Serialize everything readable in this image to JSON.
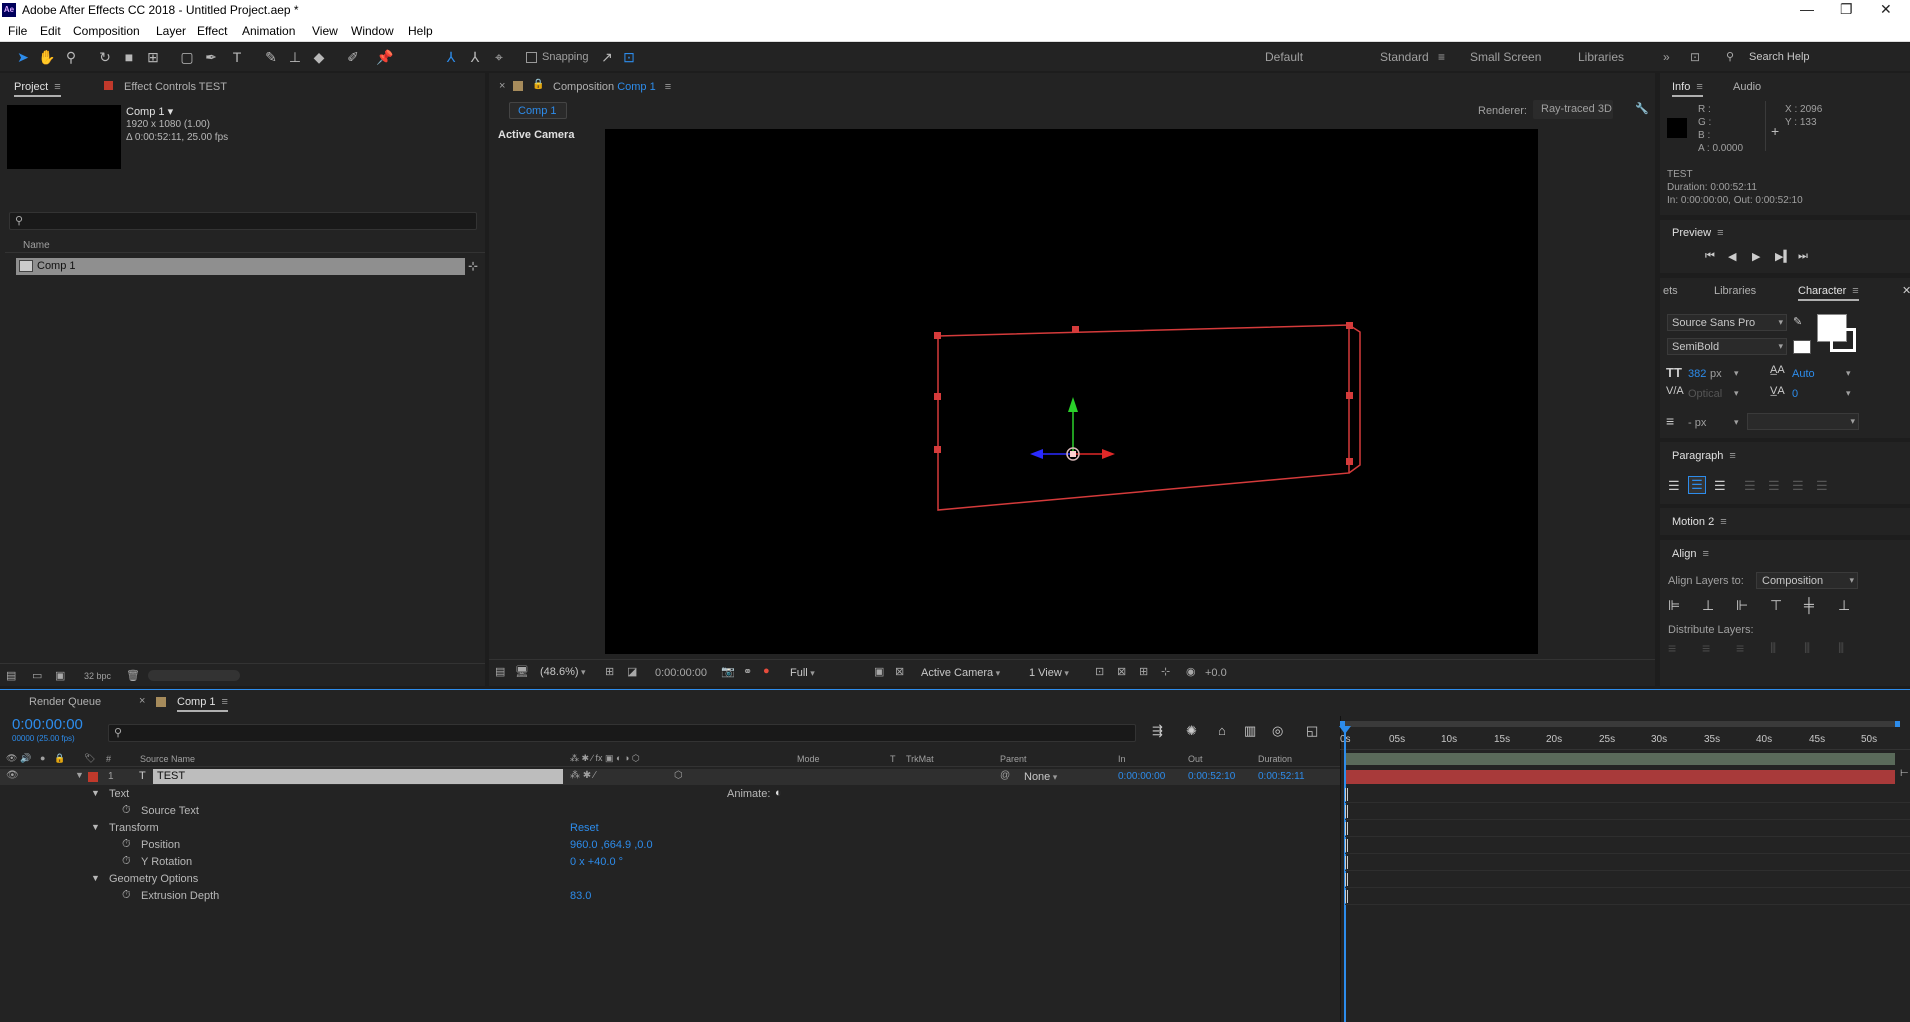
{
  "window": {
    "title": "Adobe After Effects CC 2018 - Untitled Project.aep *",
    "logo_text": "Ae",
    "controls": [
      "—",
      "❐",
      "✕"
    ]
  },
  "menu": [
    "File",
    "Edit",
    "Composition",
    "Layer",
    "Effect",
    "Animation",
    "View",
    "Window",
    "Help"
  ],
  "toolbar": {
    "snapping_label": "Snapping",
    "workspaces": [
      "Default",
      "Standard",
      "Small Screen",
      "Libraries"
    ],
    "active_workspace": "Standard",
    "search_placeholder": "Search Help"
  },
  "project_panel": {
    "tab_project": "Project",
    "tab_effect_controls": "Effect Controls TEST",
    "comp_name": "Comp 1 ▾",
    "comp_size": "1920 x 1080 (1.00)",
    "comp_duration": "Δ 0:00:52:11, 25.00 fps",
    "column_name": "Name",
    "items": [
      {
        "name": "Comp 1"
      }
    ],
    "bpc": "32 bpc"
  },
  "composition_panel": {
    "tab_prefix": "Composition",
    "tab_comp": "Comp 1",
    "crumb": "Comp 1",
    "renderer_label": "Renderer:",
    "renderer_value": "Ray-traced 3D",
    "view_label": "Active Camera",
    "zoom": "(48.6%)",
    "timecode": "0:00:00:00",
    "resolution": "Full",
    "camera": "Active Camera",
    "views": "1 View",
    "exposure": "+0.0"
  },
  "info_panel": {
    "tab_info": "Info",
    "tab_audio": "Audio",
    "r": "R :",
    "g": "G :",
    "b": "B :",
    "a": "A :  0.0000",
    "x": "X : 2096",
    "y": "Y : 133",
    "layer": "TEST",
    "duration": "Duration: 0:00:52:11",
    "in_out": "In: 0:00:00:00, Out: 0:00:52:10"
  },
  "preview_panel": {
    "title": "Preview"
  },
  "character_panel": {
    "tab_effects": "ets",
    "tab_libraries": "Libraries",
    "tab_character": "Character",
    "font": "Source Sans Pro",
    "style": "SemiBold",
    "size": "382",
    "size_unit": "px",
    "leading": "Auto",
    "kerning": "Optical",
    "tracking": "0",
    "stroke_unit": "- px"
  },
  "paragraph_panel": {
    "title": "Paragraph"
  },
  "motion_panel": {
    "title": "Motion 2"
  },
  "align_panel": {
    "title": "Align",
    "align_to_label": "Align Layers to:",
    "align_to_value": "Composition",
    "distribute_label": "Distribute Layers:"
  },
  "timeline": {
    "tab_render": "Render Queue",
    "tab_comp": "Comp 1",
    "timecode": "0:00:00:00",
    "frame_info": "00000 (25.00 fps)",
    "columns": {
      "hash": "#",
      "source_name": "Source Name",
      "mode": "Mode",
      "t": "T",
      "trkmat": "TrkMat",
      "parent": "Parent",
      "in": "In",
      "out": "Out",
      "duration": "Duration"
    },
    "layer": {
      "index": "1",
      "name": "TEST",
      "parent": "None",
      "in": "0:00:00:00",
      "out": "0:00:52:10",
      "duration": "0:00:52:11"
    },
    "animate_label": "Animate:",
    "properties": [
      {
        "label": "Text",
        "value": ""
      },
      {
        "label": "Source Text",
        "value": ""
      },
      {
        "label": "Transform",
        "value": "Reset"
      },
      {
        "label": "Position",
        "value": "960.0 ,664.9 ,0.0"
      },
      {
        "label": "Y Rotation",
        "value": "0 x +40.0 °"
      },
      {
        "label": "Geometry Options",
        "value": ""
      },
      {
        "label": "Extrusion Depth",
        "value": "83.0"
      }
    ],
    "ruler": [
      "0s",
      "05s",
      "10s",
      "15s",
      "20s",
      "25s",
      "30s",
      "35s",
      "40s",
      "45s",
      "50s"
    ]
  },
  "colors": {
    "accent": "#2d8ceb",
    "layer_bar": "#a83a3a",
    "label_red": "#c0392b",
    "bounding_box": "#d53b3b"
  }
}
